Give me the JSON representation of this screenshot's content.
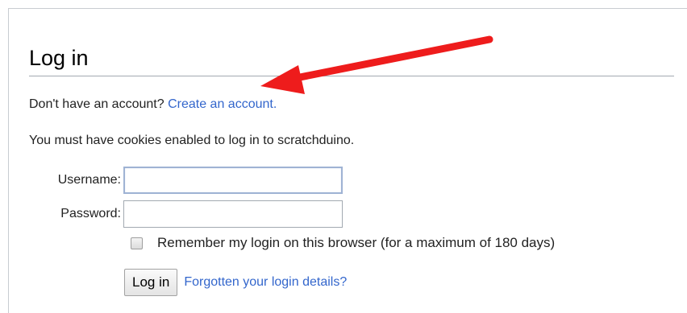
{
  "login_form": {
    "title": "Log in",
    "no_account_text": "Don't have an account?",
    "create_account_link": "Create an account.",
    "cookies_notice": "You must have cookies enabled to log in to scratchduino.",
    "username_label": "Username:",
    "username_value": "",
    "password_label": "Password:",
    "password_value": "",
    "remember_label": "Remember my login on this browser (for a maximum of 180 days)",
    "remember_checked": false,
    "login_button": "Log in",
    "forgot_link": "Forgotten your login details?"
  },
  "annotation": {
    "arrow_color": "#ee1c1c",
    "arrow_icon": "red-arrow-icon"
  },
  "colors": {
    "link": "#3366cc",
    "rule": "#a2a9b1"
  }
}
